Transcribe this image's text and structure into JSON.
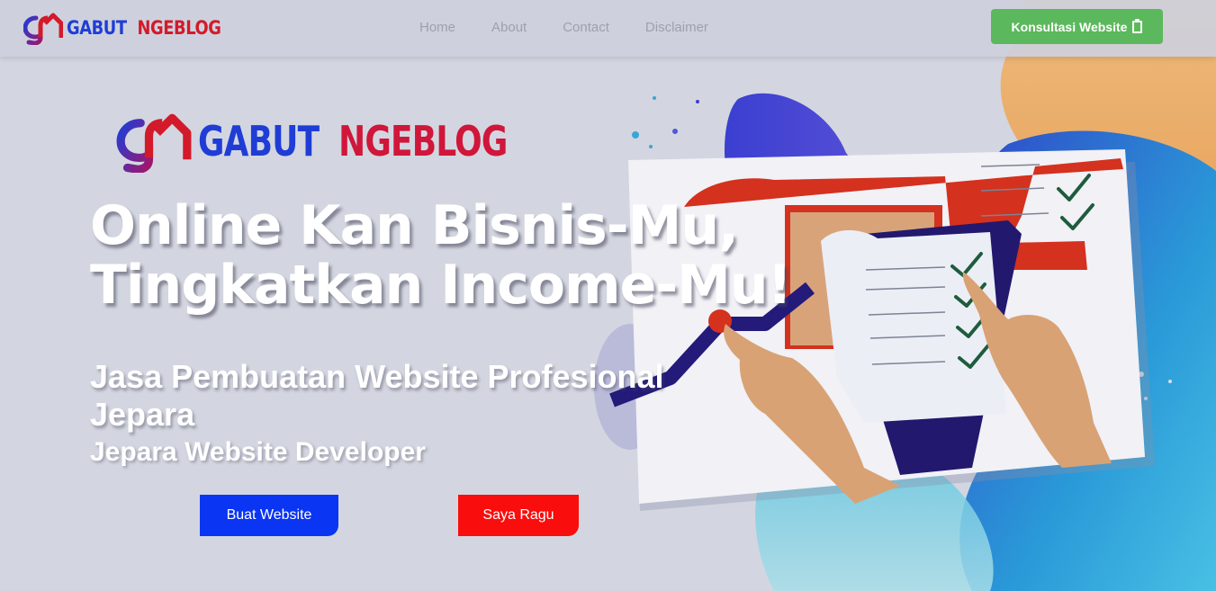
{
  "brand": {
    "word1": "GABUT",
    "word2": "NGEBLOG"
  },
  "nav": {
    "items": [
      {
        "label": "Home"
      },
      {
        "label": "About"
      },
      {
        "label": "Contact"
      },
      {
        "label": "Disclaimer"
      }
    ],
    "cta_label": "Konsultasi Website"
  },
  "hero": {
    "headline_line1": "Online Kan Bisnis-Mu,",
    "headline_line2": "Tingkatkan Income-Mu!",
    "subhead": "Jasa Pembuatan Website Profesional Jepara",
    "tagline": "Jepara Website Developer",
    "primary_button": "Buat Website",
    "secondary_button": "Saya Ragu"
  },
  "colors": {
    "brand_blue": "#1f3dd6",
    "brand_red": "#d31a2a",
    "cta_green": "#5cb85c",
    "primary_button": "#0a35f2",
    "secondary_button": "#fa0d0d"
  },
  "icons": {
    "logo": "gn-house-logo-icon",
    "cta": "clipboard-icon"
  }
}
